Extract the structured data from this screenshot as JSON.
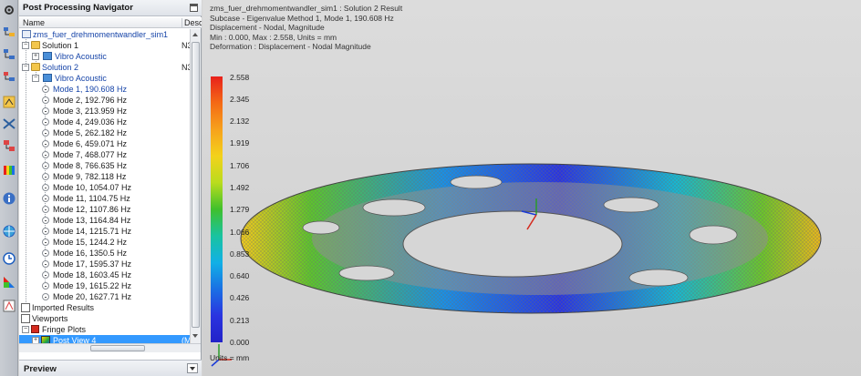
{
  "navigator": {
    "title": "Post Processing Navigator",
    "columns": {
      "name": "Name",
      "description": "Desc"
    },
    "tree": {
      "sim_file": "zms_fuer_drehmomentwandler_sim1",
      "solution1": {
        "label": "Solution 1",
        "desc": "N3",
        "vibro": "Vibro Acoustic"
      },
      "solution2": {
        "label": "Solution 2",
        "desc": "N3",
        "vibro": "Vibro Acoustic"
      },
      "modes": [
        "Mode 1, 190.608 Hz",
        "Mode 2, 192.796 Hz",
        "Mode 3, 213.959 Hz",
        "Mode 4, 249.036 Hz",
        "Mode 5, 262.182 Hz",
        "Mode 6, 459.071 Hz",
        "Mode 7, 468.077 Hz",
        "Mode 8, 766.635 Hz",
        "Mode 9, 782.118 Hz",
        "Mode 10, 1054.07 Hz",
        "Mode 11, 1104.75 Hz",
        "Mode 12, 1107.86 Hz",
        "Mode 13, 1164.84 Hz",
        "Mode 14, 1215.71 Hz",
        "Mode 15, 1244.2 Hz",
        "Mode 16, 1350.5 Hz",
        "Mode 17, 1595.37 Hz",
        "Mode 18, 1603.45 Hz",
        "Mode 19, 1615.22 Hz",
        "Mode 20, 1627.71 Hz"
      ],
      "imported_results": "Imported Results",
      "viewports": "Viewports",
      "fringe_plots": "Fringe Plots",
      "post_view": {
        "label": "Post View 4",
        "desc": "(M"
      }
    },
    "preview": "Preview"
  },
  "graphics": {
    "info_lines": [
      "zms_fuer_drehmomentwandler_sim1 : Solution 2 Result",
      "Subcase - Eigenvalue Method 1, Mode 1, 190.608 Hz",
      "Displacement - Nodal, Magnitude",
      "Min : 0.000, Max : 2.558, Units = mm",
      "Deformation : Displacement - Nodal Magnitude"
    ],
    "legend": {
      "values": [
        "2.558",
        "2.345",
        "2.132",
        "1.919",
        "1.706",
        "1.492",
        "1.279",
        "1.066",
        "0.853",
        "0.640",
        "0.426",
        "0.213",
        "0.000"
      ],
      "units_label": "Units = mm"
    }
  },
  "colors": {
    "selection": "#3399ff",
    "tree_link": "#1644a8",
    "fringe_max": "#e8211b",
    "fringe_min": "#2222c8"
  }
}
